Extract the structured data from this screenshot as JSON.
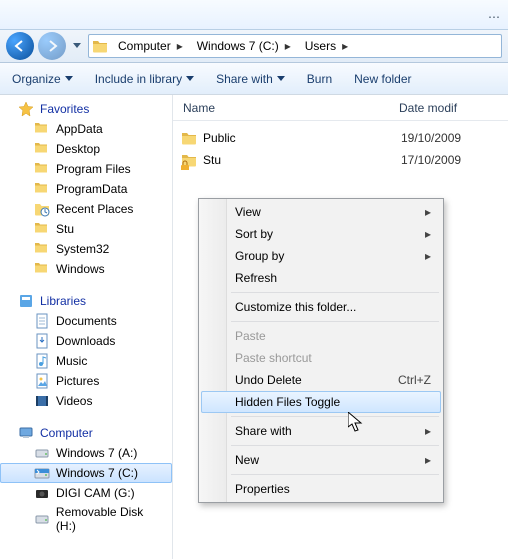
{
  "breadcrumb": {
    "computer": "Computer",
    "drive": "Windows 7  (C:)",
    "folder": "Users"
  },
  "toolbar": {
    "organize": "Organize",
    "include": "Include in library",
    "share": "Share with",
    "burn": "Burn",
    "newfolder": "New folder"
  },
  "columns": {
    "name": "Name",
    "date": "Date modif"
  },
  "files": [
    {
      "name": "Public",
      "date": "19/10/2009",
      "overlay": null
    },
    {
      "name": "Stu",
      "date": "17/10/2009",
      "overlay": "lock"
    }
  ],
  "side": {
    "favorites": {
      "label": "Favorites",
      "items": [
        "AppData",
        "Desktop",
        "Program Files",
        "ProgramData",
        "Recent Places",
        "Stu",
        "System32",
        "Windows"
      ]
    },
    "libraries": {
      "label": "Libraries",
      "items": [
        "Documents",
        "Downloads",
        "Music",
        "Pictures",
        "Videos"
      ]
    },
    "computer": {
      "label": "Computer",
      "items": [
        "Windows 7  (A:)",
        "Windows 7  (C:)",
        "DIGI CAM (G:)",
        "Removable Disk (H:)"
      ]
    }
  },
  "context": {
    "view": "View",
    "sortby": "Sort by",
    "groupby": "Group by",
    "refresh": "Refresh",
    "customize": "Customize this folder...",
    "paste": "Paste",
    "pasteshortcut": "Paste shortcut",
    "undo": "Undo Delete",
    "undokey": "Ctrl+Z",
    "hiddentoggle": "Hidden Files Toggle",
    "sharewith": "Share with",
    "new": "New",
    "properties": "Properties"
  }
}
